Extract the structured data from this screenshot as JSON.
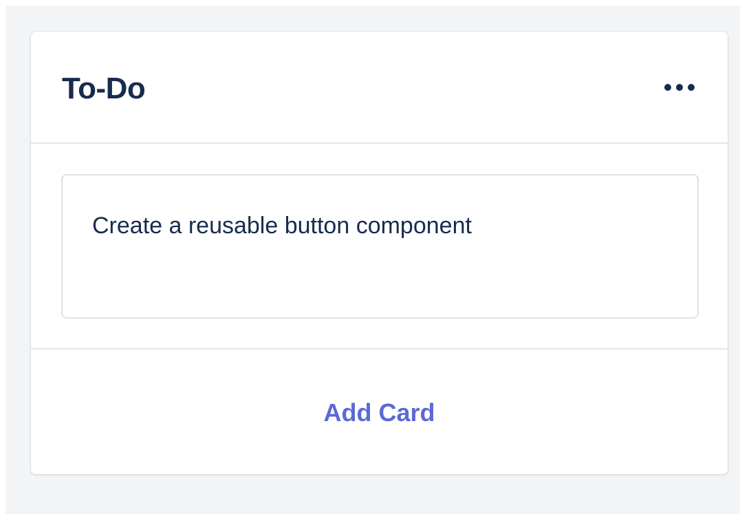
{
  "column": {
    "title": "To-Do",
    "menu_icon": "more-horizontal-icon",
    "cards": [
      {
        "text": "Create a reusable button component"
      }
    ],
    "add_card_label": "Add Card"
  },
  "colors": {
    "background": "#f3f4f6",
    "title_text": "#172b4d",
    "accent": "#5b6ad6",
    "border": "#dfe1e6"
  }
}
